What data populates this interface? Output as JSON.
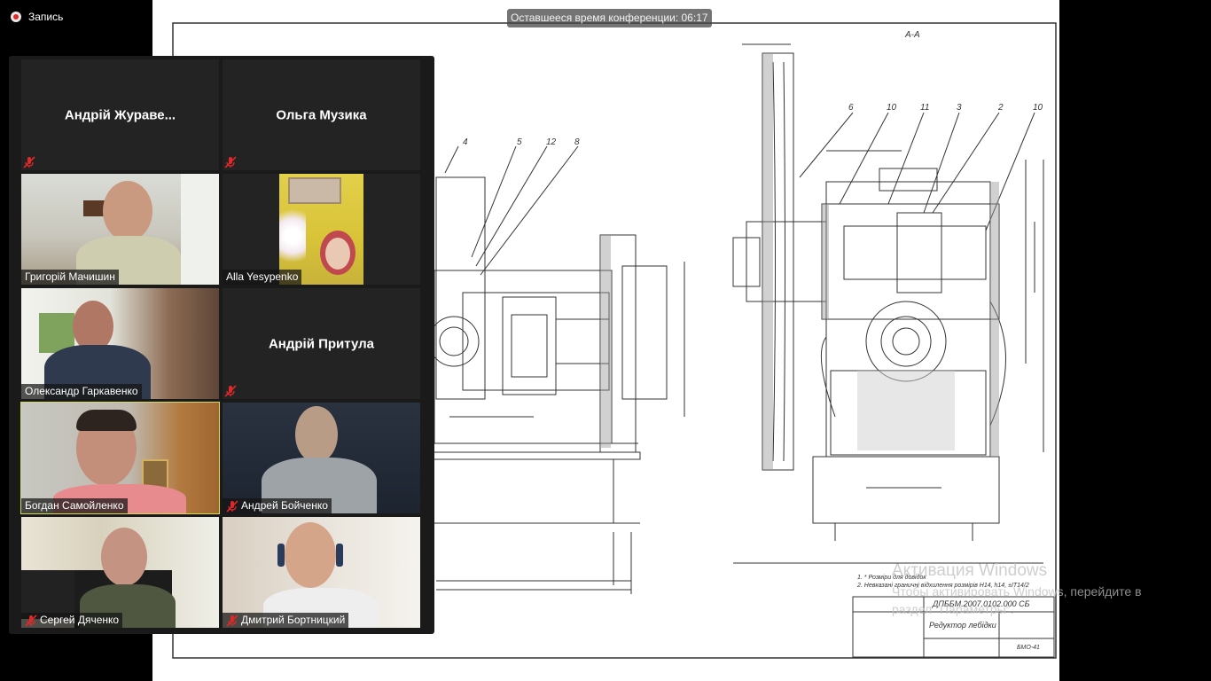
{
  "recording": {
    "label": "Запись"
  },
  "timer": {
    "text": "Оставшееся время конференции: 06:17"
  },
  "participants": [
    {
      "name": "Андрій  Жураве...",
      "video": false,
      "muted": true
    },
    {
      "name": "Ольга Музика",
      "video": false,
      "muted": true
    },
    {
      "name": "Григорій Мачишин",
      "video": true,
      "muted": false
    },
    {
      "name": "Alla Yesypenko",
      "video": true,
      "muted": false
    },
    {
      "name": "Олександр Гаркавенко",
      "video": true,
      "muted": false
    },
    {
      "name": "Андрій Притула",
      "video": false,
      "muted": true
    },
    {
      "name": "Богдан Самойленко",
      "video": true,
      "muted": false,
      "active_speaker": true
    },
    {
      "name": "Андрей Бойченко",
      "video": true,
      "muted": true
    },
    {
      "name": "Сергей Дяченко",
      "video": true,
      "muted": true
    },
    {
      "name": "Дмитрий Бортницкий",
      "video": true,
      "muted": true
    }
  ],
  "drawing": {
    "section_label": "А-А",
    "callouts": [
      "4",
      "5",
      "12",
      "8",
      "6",
      "10",
      "11",
      "3",
      "2",
      "10"
    ],
    "notes": [
      "1. * Розміри для довідок",
      "2. Невказані граничні відхилення розмірів H14, h14, ±IT14/2"
    ],
    "title_block": {
      "designation": "ДПББМ.2007.0102.000 СБ",
      "name": "Редуктор лебідки",
      "group": "БМО-41"
    }
  },
  "windows_watermark": {
    "title": "Активация Windows",
    "subtitle": "Чтобы активировать Windows, перейдите в",
    "subtitle2": "раздел \"Параметры\"."
  },
  "colors": {
    "active_speaker_border": "#d4dc5a",
    "mute_icon": "#e02828",
    "panel_bg": "#1a1a1a"
  }
}
